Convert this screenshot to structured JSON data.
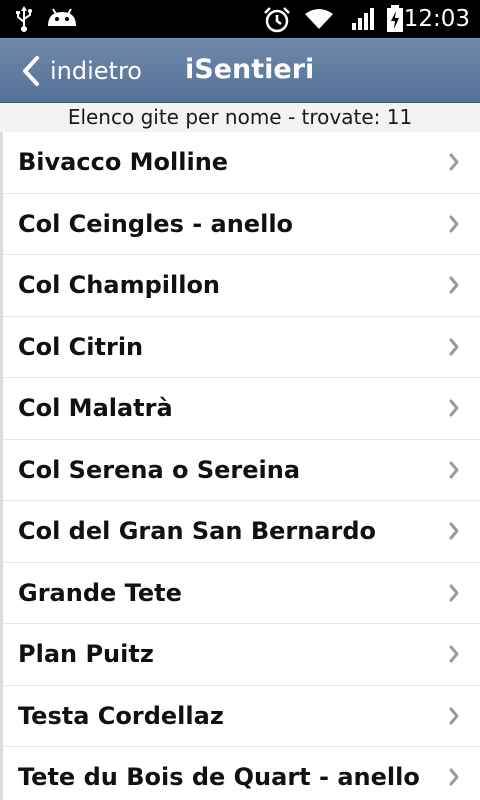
{
  "status_bar": {
    "time": "12:03",
    "icons": [
      "usb-icon",
      "android-icon",
      "alarm-icon",
      "wifi-icon",
      "signal-icon",
      "battery-charging-icon"
    ]
  },
  "nav": {
    "back_label": "indietro",
    "title": "iSentieri",
    "bar_color": "#5f7aa0"
  },
  "subtitle": "Elenco gite per nome - trovate: 11",
  "list": {
    "items": [
      {
        "label": "Bivacco Molline"
      },
      {
        "label": "Col Ceingles - anello"
      },
      {
        "label": "Col Champillon"
      },
      {
        "label": "Col Citrin"
      },
      {
        "label": "Col Malatrà"
      },
      {
        "label": "Col Serena o Sereina"
      },
      {
        "label": "Col del Gran San Bernardo"
      },
      {
        "label": "Grande Tete"
      },
      {
        "label": "Plan Puitz"
      },
      {
        "label": "Testa Cordellaz"
      },
      {
        "label": "Tete du Bois de Quart - anello"
      }
    ]
  }
}
